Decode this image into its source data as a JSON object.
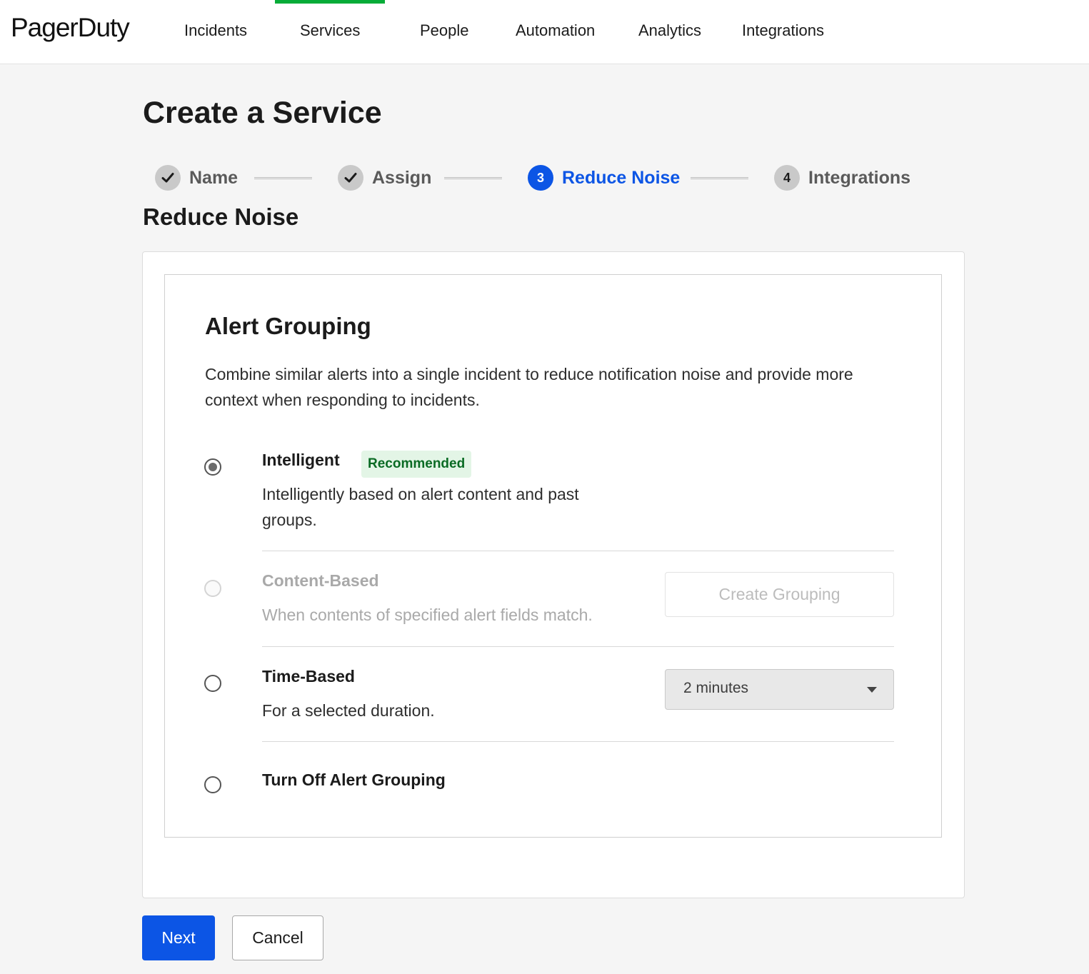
{
  "brand": {
    "logo": "PagerDuty",
    "accent": "#06ac38",
    "primary": "#0c55e5"
  },
  "nav": {
    "items": [
      {
        "label": "Incidents",
        "active": false
      },
      {
        "label": "Services",
        "active": true
      },
      {
        "label": "People",
        "active": false
      },
      {
        "label": "Automation",
        "active": false
      },
      {
        "label": "Analytics",
        "active": false
      },
      {
        "label": "Integrations",
        "active": false
      }
    ]
  },
  "page": {
    "title": "Create a Service"
  },
  "stepper": {
    "steps": [
      {
        "label": "Name",
        "state": "complete",
        "icon": "check-icon"
      },
      {
        "label": "Assign",
        "state": "complete",
        "icon": "check-icon"
      },
      {
        "label": "Reduce Noise",
        "state": "current",
        "number": "3"
      },
      {
        "label": "Integrations",
        "state": "upcoming",
        "number": "4"
      }
    ]
  },
  "section": {
    "title": "Reduce Noise"
  },
  "alert_grouping": {
    "title": "Alert Grouping",
    "description": "Combine similar alerts into a single incident to reduce notification noise and provide more context when responding to incidents.",
    "options": [
      {
        "title": "Intelligent",
        "badge": "Recommended",
        "description": "Intelligently based on alert content and past groups.",
        "selected": true,
        "disabled": false
      },
      {
        "title": "Content-Based",
        "description": "When contents of specified alert fields match.",
        "action_label": "Create Grouping",
        "selected": false,
        "disabled": true
      },
      {
        "title": "Time-Based",
        "description": "For a selected duration.",
        "select_value": "2 minutes",
        "selected": false,
        "disabled": false
      },
      {
        "title": "Turn Off Alert Grouping",
        "selected": false,
        "disabled": false
      }
    ]
  },
  "footer": {
    "next_label": "Next",
    "cancel_label": "Cancel"
  }
}
